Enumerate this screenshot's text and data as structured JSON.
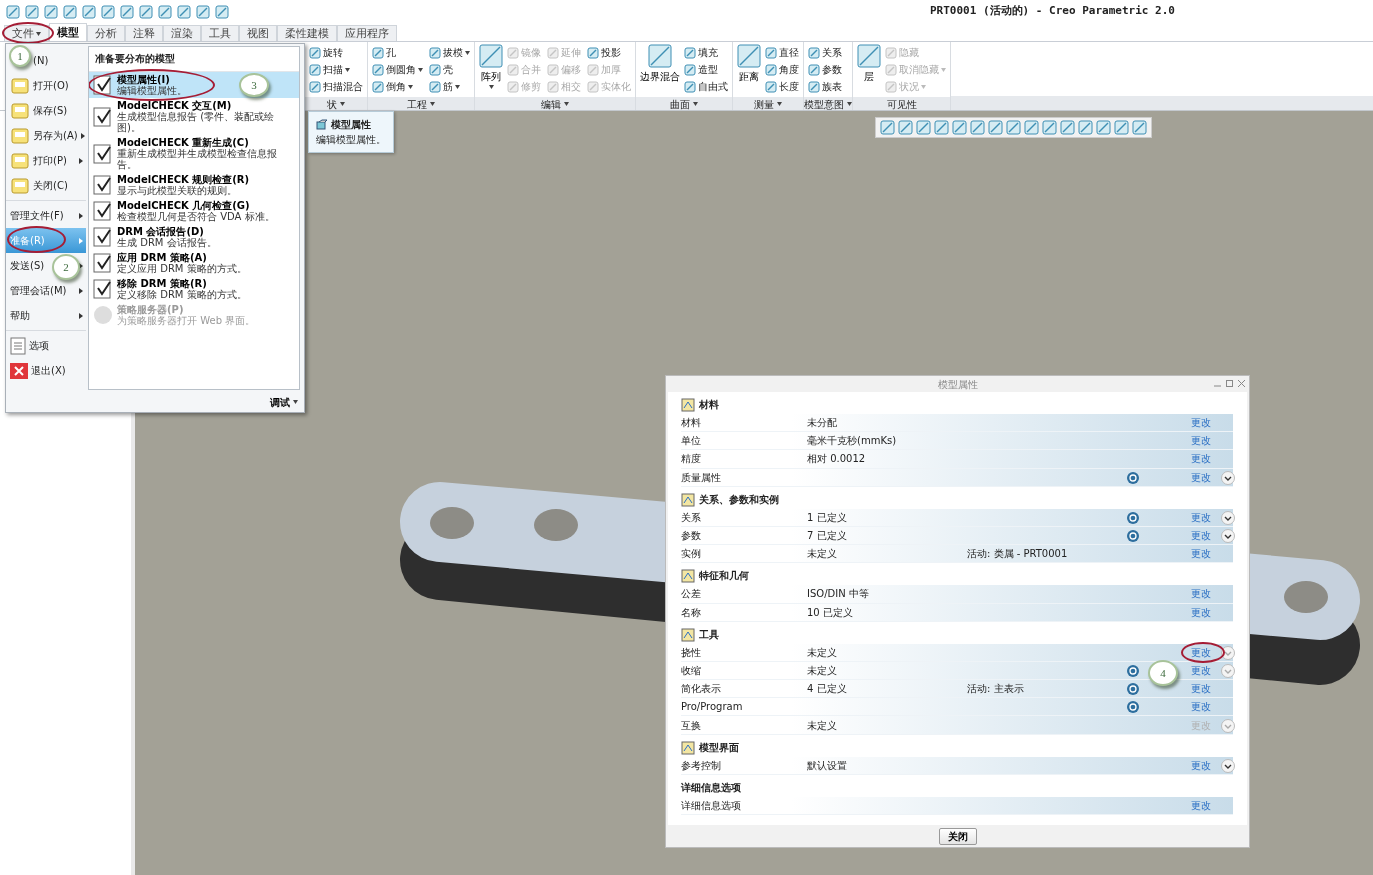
{
  "window": {
    "title": "PRT0001 (活动的) - Creo Parametric 2.0"
  },
  "tabs": [
    {
      "label": "文件",
      "selected": false,
      "dropdown": true
    },
    {
      "label": "模型",
      "selected": true,
      "dropdown": false
    },
    {
      "label": "分析",
      "selected": false,
      "dropdown": false
    },
    {
      "label": "注释",
      "selected": false,
      "dropdown": false
    },
    {
      "label": "渲染",
      "selected": false,
      "dropdown": false
    },
    {
      "label": "工具",
      "selected": false,
      "dropdown": false
    },
    {
      "label": "视图",
      "selected": false,
      "dropdown": false
    },
    {
      "label": "柔性建模",
      "selected": false,
      "dropdown": false
    },
    {
      "label": "应用程序",
      "selected": false,
      "dropdown": false
    }
  ],
  "ribbon": [
    {
      "label": "状",
      "dropdown": true,
      "items": [
        {
          "label": "旋转",
          "kind": "small",
          "disabled": false,
          "dropdown": false
        },
        {
          "label": "扫描",
          "kind": "small",
          "disabled": false,
          "dropdown": true
        },
        {
          "label": "扫描混合",
          "kind": "small",
          "disabled": false,
          "dropdown": false
        }
      ]
    },
    {
      "label": "工程",
      "dropdown": true,
      "items": [
        {
          "label": "孔",
          "kind": "small",
          "disabled": false,
          "dropdown": false
        },
        {
          "label": "倒圆角",
          "kind": "small",
          "disabled": false,
          "dropdown": true
        },
        {
          "label": "倒角",
          "kind": "small",
          "disabled": false,
          "dropdown": true
        },
        {
          "label": "拔模",
          "kind": "small",
          "disabled": false,
          "dropdown": true
        },
        {
          "label": "壳",
          "kind": "small",
          "disabled": false,
          "dropdown": false
        },
        {
          "label": "筋",
          "kind": "small",
          "disabled": false,
          "dropdown": true
        }
      ]
    },
    {
      "label": "编辑",
      "dropdown": true,
      "items": [
        {
          "label": "阵列",
          "kind": "large",
          "disabled": false,
          "dropdown": true
        },
        {
          "label": "镜像",
          "kind": "small",
          "disabled": true,
          "dropdown": false
        },
        {
          "label": "合并",
          "kind": "small",
          "disabled": true,
          "dropdown": false
        },
        {
          "label": "修剪",
          "kind": "small",
          "disabled": true,
          "dropdown": false
        },
        {
          "label": "延伸",
          "kind": "small",
          "disabled": true,
          "dropdown": false
        },
        {
          "label": "偏移",
          "kind": "small",
          "disabled": true,
          "dropdown": false
        },
        {
          "label": "相交",
          "kind": "small",
          "disabled": true,
          "dropdown": false
        },
        {
          "label": "投影",
          "kind": "small",
          "disabled": false,
          "dropdown": false
        },
        {
          "label": "加厚",
          "kind": "small",
          "disabled": true,
          "dropdown": false
        },
        {
          "label": "实体化",
          "kind": "small",
          "disabled": true,
          "dropdown": false
        }
      ]
    },
    {
      "label": "曲面",
      "dropdown": true,
      "items": [
        {
          "label": "边界混合",
          "kind": "large",
          "disabled": false,
          "dropdown": false
        },
        {
          "label": "填充",
          "kind": "small",
          "disabled": false,
          "dropdown": false
        },
        {
          "label": "造型",
          "kind": "small",
          "disabled": false,
          "dropdown": false
        },
        {
          "label": "自由式",
          "kind": "small",
          "disabled": false,
          "dropdown": false
        }
      ]
    },
    {
      "label": "测量",
      "dropdown": true,
      "items": [
        {
          "label": "距离",
          "kind": "large",
          "disabled": false,
          "dropdown": false
        },
        {
          "label": "直径",
          "kind": "small",
          "disabled": false,
          "dropdown": false
        },
        {
          "label": "角度",
          "kind": "small",
          "disabled": false,
          "dropdown": false
        },
        {
          "label": "长度",
          "kind": "small",
          "disabled": false,
          "dropdown": false
        }
      ]
    },
    {
      "label": "模型意图",
      "dropdown": true,
      "items": [
        {
          "label": "关系",
          "kind": "small",
          "disabled": false,
          "dropdown": false
        },
        {
          "label": "参数",
          "kind": "small",
          "disabled": false,
          "dropdown": false
        },
        {
          "label": "族表",
          "kind": "small",
          "disabled": false,
          "dropdown": false
        }
      ]
    },
    {
      "label": "可见性",
      "dropdown": false,
      "items": [
        {
          "label": "层",
          "kind": "large",
          "disabled": false,
          "dropdown": false
        },
        {
          "label": "隐藏",
          "kind": "small",
          "disabled": true,
          "dropdown": false
        },
        {
          "label": "取消隐藏",
          "kind": "small",
          "disabled": true,
          "dropdown": true
        },
        {
          "label": "状况",
          "kind": "small",
          "disabled": true,
          "dropdown": true
        }
      ]
    }
  ],
  "file_menu": {
    "groups": [
      [
        {
          "label": "(N)",
          "kind": "covered",
          "submenu": false,
          "selected": false
        },
        {
          "label": "打开(O)",
          "kind": "large",
          "submenu": false,
          "selected": false
        },
        {
          "label": "保存(S)",
          "kind": "large",
          "submenu": false,
          "selected": false
        },
        {
          "label": "另存为(A)",
          "kind": "large",
          "submenu": true,
          "selected": false
        },
        {
          "label": "打印(P)",
          "kind": "large",
          "submenu": true,
          "selected": false
        },
        {
          "label": "关闭(C)",
          "kind": "large",
          "submenu": false,
          "selected": false
        }
      ],
      [
        {
          "label": "管理文件(F)",
          "kind": "plain",
          "submenu": true,
          "selected": false
        },
        {
          "label": "准备(R)",
          "kind": "plain",
          "submenu": true,
          "selected": true
        },
        {
          "label": "发送(S)",
          "kind": "plain",
          "submenu": true,
          "selected": false
        },
        {
          "label": "管理会话(M)",
          "kind": "plain",
          "submenu": true,
          "selected": false
        },
        {
          "label": "帮助",
          "kind": "plain",
          "submenu": true,
          "selected": false
        }
      ],
      [
        {
          "label": "选项",
          "kind": "option",
          "submenu": false,
          "selected": false
        },
        {
          "label": "退出(X)",
          "kind": "exit",
          "submenu": false,
          "selected": false
        }
      ]
    ],
    "submenu": {
      "title": "准备要分布的模型",
      "items": [
        {
          "title": "模型属性(I)",
          "description": "编辑模型属性。",
          "selected": true,
          "disabled": false
        },
        {
          "title": "ModelCHECK 交互(M)",
          "description": "生成模型信息报告 (零件、装配或绘图)。",
          "selected": false,
          "disabled": false
        },
        {
          "title": "ModelCHECK 重新生成(C)",
          "description": "重新生成模型并生成模型检查信息报告。",
          "selected": false,
          "disabled": false
        },
        {
          "title": "ModelCHECK 规则检查(R)",
          "description": "显示与此模型关联的规则。",
          "selected": false,
          "disabled": false
        },
        {
          "title": "ModelCHECK 几何检查(G)",
          "description": "检查模型几何是否符合 VDA 标准。",
          "selected": false,
          "disabled": false
        },
        {
          "title": "DRM 会话报告(D)",
          "description": "生成 DRM 会话报告。",
          "selected": false,
          "disabled": false
        },
        {
          "title": "应用 DRM 策略(A)",
          "description": "定义应用 DRM 策略的方式。",
          "selected": false,
          "disabled": false
        },
        {
          "title": "移除 DRM 策略(R)",
          "description": "定义移除 DRM 策略的方式。",
          "selected": false,
          "disabled": false
        },
        {
          "title": "策略服务器(P)",
          "description": "为策略服务器打开 Web 界面。",
          "selected": false,
          "disabled": true
        }
      ],
      "footer": "调试"
    }
  },
  "tooltip": {
    "title": "模型属性",
    "description": "编辑模型属性。"
  },
  "dialog": {
    "title": "模型属性",
    "sections": [
      {
        "title": "材料",
        "icon": true,
        "rows": [
          {
            "label": "材料",
            "value": "未分配",
            "change": "更改",
            "change_disabled": false
          },
          {
            "label": "单位",
            "value": "毫米千克秒(mmKs)",
            "change": "更改",
            "change_disabled": false
          },
          {
            "label": "精度",
            "value": "相对 0.0012",
            "change": "更改",
            "change_disabled": false
          },
          {
            "label": "质量属性",
            "info": true,
            "change": "更改",
            "change_disabled": false,
            "expander_dimmed": false
          }
        ]
      },
      {
        "title": "关系、参数和实例",
        "icon": true,
        "rows": [
          {
            "label": "关系",
            "value": "1 已定义",
            "info": true,
            "change": "更改",
            "change_disabled": false,
            "expander_dimmed": false
          },
          {
            "label": "参数",
            "value": "7 已定义",
            "info": true,
            "change": "更改",
            "change_disabled": false,
            "expander_dimmed": false
          },
          {
            "label": "实例",
            "value": "未定义",
            "extra": "活动: 类属 - PRT0001",
            "change": "更改",
            "change_disabled": false
          }
        ]
      },
      {
        "title": "特征和几何",
        "icon": true,
        "rows": [
          {
            "label": "公差",
            "value": "ISO/DIN 中等",
            "change": "更改",
            "change_disabled": false
          },
          {
            "label": "名称",
            "value": "10 已定义",
            "change": "更改",
            "change_disabled": false
          }
        ]
      },
      {
        "title": "工具",
        "icon": true,
        "rows": [
          {
            "label": "挠性",
            "value": "未定义",
            "change": "更改",
            "change_disabled": false,
            "expander_dimmed": true
          },
          {
            "label": "收缩",
            "value": "未定义",
            "info": true,
            "change": "更改",
            "change_disabled": false,
            "expander_dimmed": true
          },
          {
            "label": "简化表示",
            "value": "4 已定义",
            "extra": "活动: 主表示",
            "info": true,
            "change": "更改",
            "change_disabled": false
          },
          {
            "label": "Pro/Program",
            "info": true,
            "change": "更改",
            "change_disabled": false
          },
          {
            "label": "互换",
            "value": "未定义",
            "change": "更改",
            "change_disabled": true,
            "expander_dimmed": true
          }
        ]
      },
      {
        "title": "模型界面",
        "icon": true,
        "rows": [
          {
            "label": "参考控制",
            "value": "默认设置",
            "change": "更改",
            "change_disabled": false,
            "expander_dimmed": false
          }
        ]
      },
      {
        "title": "详细信息选项",
        "icon": false,
        "rows": [
          {
            "label": "详细信息选项",
            "change": "更改",
            "change_disabled": false
          }
        ]
      }
    ],
    "close": "关闭"
  },
  "callouts": [
    {
      "label": "1"
    },
    {
      "label": "2"
    },
    {
      "label": "3"
    },
    {
      "label": "4"
    }
  ]
}
